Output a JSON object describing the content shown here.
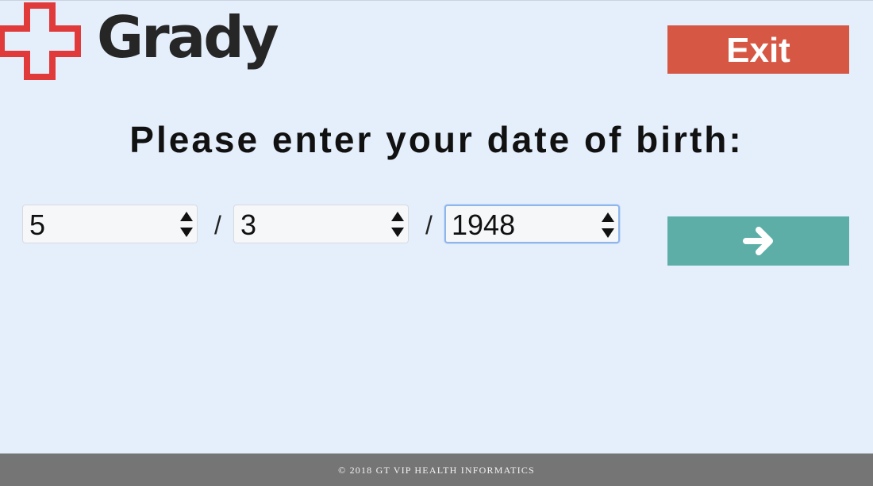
{
  "logo": {
    "text": "Grady",
    "icon": "red-cross-icon",
    "color": "#e03a3a"
  },
  "header": {
    "exit_label": "Exit",
    "exit_color": "#d65844"
  },
  "main": {
    "title": "Please enter your date of birth:",
    "date_fields": [
      {
        "value": "5"
      },
      {
        "value": "3"
      },
      {
        "value": "1948"
      }
    ],
    "separator": "/",
    "next_icon": "arrow-right-icon",
    "next_color": "#5eaea8"
  },
  "footer": {
    "text": "© 2018 GT VIP HEALTH INFORMATICS"
  }
}
